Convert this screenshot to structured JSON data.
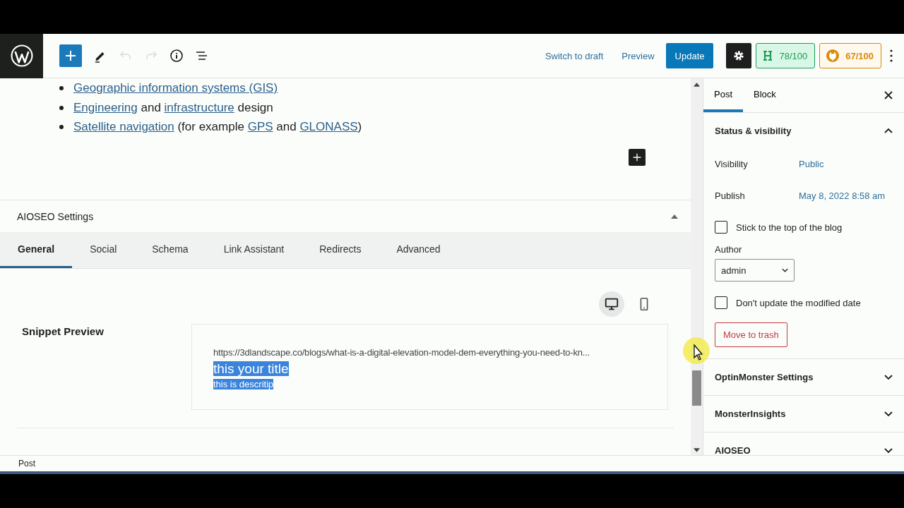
{
  "toolbar": {
    "left_buttons": [
      {
        "kind": "add",
        "disabled": false
      },
      {
        "kind": "edit",
        "disabled": false
      },
      {
        "kind": "undo",
        "disabled": true
      },
      {
        "kind": "redo",
        "disabled": true
      },
      {
        "kind": "info",
        "disabled": false
      },
      {
        "kind": "outline",
        "disabled": false
      }
    ],
    "switch_to_draft": "Switch to draft",
    "preview": "Preview",
    "update": "Update",
    "scores": [
      {
        "kind": "headline",
        "label": "78/100",
        "color": "#1f9d55"
      },
      {
        "kind": "seo",
        "label": "67/100",
        "color": "#d98a0a"
      }
    ]
  },
  "content": {
    "list": [
      [
        {
          "text": "Geographic information systems (GIS)",
          "link": true
        }
      ],
      [
        {
          "text": "Engineering",
          "link": true
        },
        {
          "text": " and ",
          "link": false
        },
        {
          "text": "infrastructure",
          "link": true
        },
        {
          "text": " design",
          "link": false
        }
      ],
      [
        {
          "text": "Satellite navigation",
          "link": true
        },
        {
          "text": " (for example ",
          "link": false
        },
        {
          "text": "GPS",
          "link": true
        },
        {
          "text": " and ",
          "link": false
        },
        {
          "text": "GLONASS",
          "link": true
        },
        {
          "text": ")",
          "link": false
        }
      ]
    ]
  },
  "aioseo": {
    "title": "AIOSEO Settings",
    "expanded": true,
    "tabs": [
      {
        "label": "General",
        "selected": true
      },
      {
        "label": "Social",
        "selected": false
      },
      {
        "label": "Schema",
        "selected": false
      },
      {
        "label": "Link Assistant",
        "selected": false
      },
      {
        "label": "Redirects",
        "selected": false
      },
      {
        "label": "Advanced",
        "selected": false
      }
    ],
    "devices": [
      {
        "kind": "desktop",
        "selected": true
      },
      {
        "kind": "mobile",
        "selected": false
      }
    ],
    "snippet_label": "Snippet Preview",
    "snippet": {
      "url": "https://3dlandscape.co/blogs/what-is-a-digital-elevation-model-dem-everything-you-need-to-kn...",
      "title": {
        "text": "this your title",
        "highlighted": true
      },
      "description": {
        "text": "this is descritip",
        "highlighted": true
      }
    }
  },
  "sidebar": {
    "tabs": [
      {
        "label": "Post",
        "selected": true
      },
      {
        "label": "Block",
        "selected": false
      }
    ],
    "panel": {
      "title": "Status & visibility",
      "expanded": true,
      "rows": [
        {
          "label": "Visibility",
          "value": "Public"
        },
        {
          "label": "Publish",
          "value": "May 8, 2022 8:58 am"
        }
      ],
      "stick": {
        "label": "Stick to the top of the blog",
        "checked": false
      },
      "author_label": "Author",
      "author": "admin",
      "modified": {
        "label": "Don't update the modified date",
        "checked": false
      },
      "trash": "Move to trash"
    },
    "sections": [
      {
        "title": "OptinMonster Settings",
        "expanded": false
      },
      {
        "title": "MonsterInsights",
        "expanded": false
      },
      {
        "title": "AIOSEO",
        "expanded": false
      }
    ]
  },
  "footer": {
    "breadcrumb": "Post"
  }
}
